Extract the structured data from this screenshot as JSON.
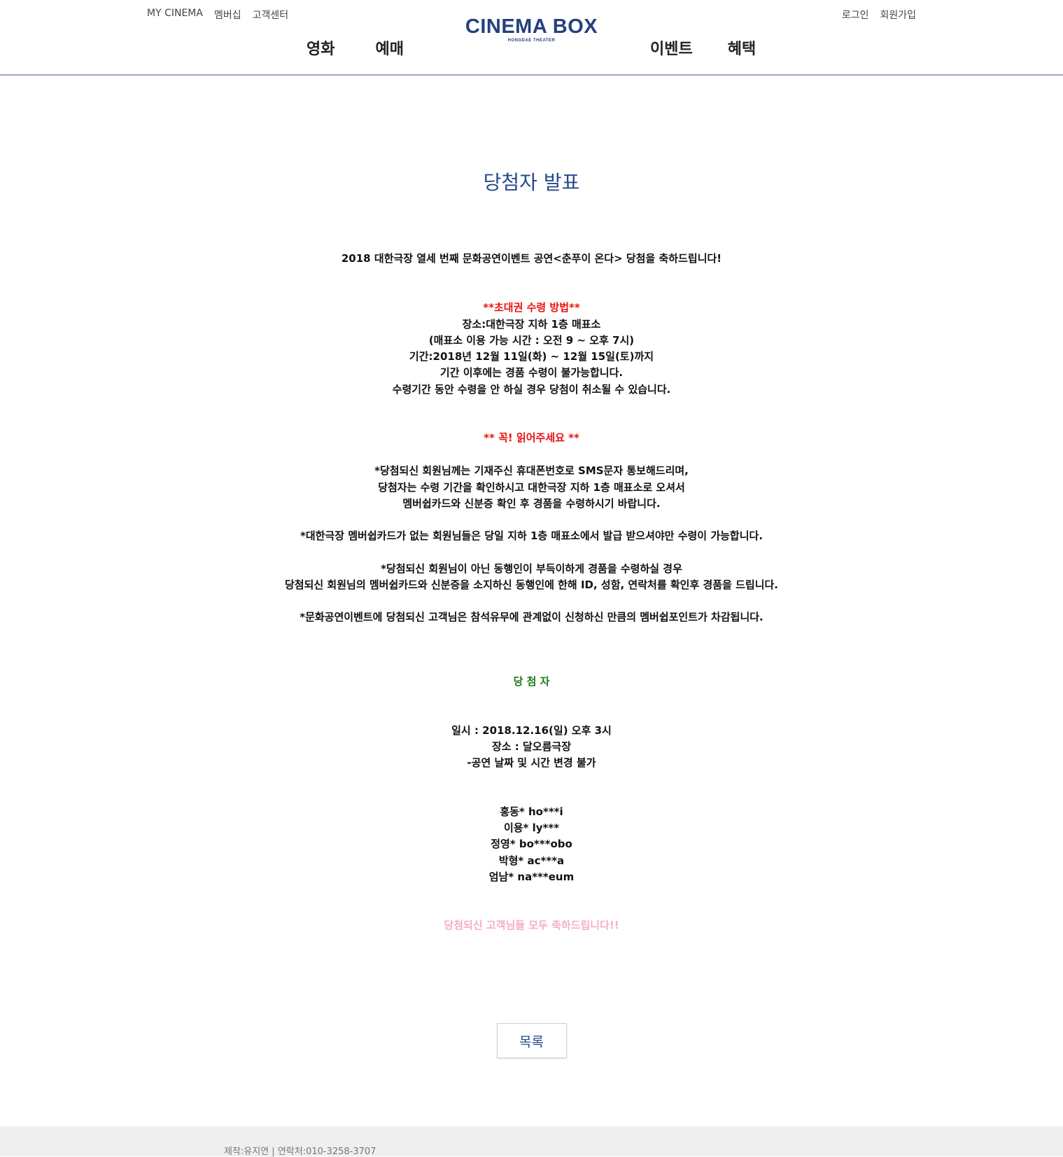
{
  "header": {
    "top_left_links": [
      "MY CINEMA",
      "멤버십",
      "고객센터"
    ],
    "top_right_links": [
      "로그인",
      "회원가입"
    ],
    "logo": {
      "main": "CINEMA BOX",
      "sub": "HONGDAE THEATER"
    },
    "nav_left": [
      "영화",
      "예매"
    ],
    "nav_right": [
      "이벤트",
      "혜택"
    ]
  },
  "page": {
    "title": "당첨자 발표"
  },
  "article": {
    "congrats": "2018 대한극장 열세 번째 문화공연이벤트 공연<춘푸이 온다> 당첨을 축하드립니다!",
    "pickup_heading": "**초대권 수령 방법**",
    "pickup_lines": [
      "장소:대한극장 지하 1층 매표소",
      "(매표소 이용 가능 시간 : 오전 9 ~ 오후 7시)",
      "기간:2018년 12월 11일(화) ~ 12월 15일(토)까지",
      "기간 이후에는 경품 수령이 불가능합니다.",
      "수령기간 동안 수령을 안 하실 경우 당첨이 취소될 수 있습니다."
    ],
    "notice_heading": "** 꼭! 읽어주세요 **",
    "notice_block_1": [
      "*당첨되신 회원님께는 기재주신 휴대폰번호로 SMS문자 통보해드리며,",
      "당첨자는 수령 기간을 확인하시고 대한극장 지하 1층 매표소로 오셔서",
      "멤버쉽카드와 신분증 확인 후 경품을 수령하시기 바랍니다."
    ],
    "notice_block_2": "*대한극장 멤버쉽카드가 없는 회원님들은 당일 지하 1층 매표소에서 발급 받으셔야만 수령이 가능합니다.",
    "notice_block_3": [
      "*당첨되신 회원님이 아닌 동행인이 부득이하게 경품을 수령하실 경우",
      "당첨되신 회원님의 멤버쉽카드와 신분증을 소지하신 동행인에 한해 ID, 성함, 연락처를 확인후 경품을 드립니다."
    ],
    "notice_block_4": "*문화공연이벤트에 당첨되신 고객님은 참석유무에 관계없이 신청하신 만큼의 멤버쉽포인트가 차감됩니다.",
    "winners_heading": "당 첨 자",
    "event_info": [
      "일시 : 2018.12.16(일) 오후 3시",
      "장소 : 달오름극장",
      "-공연 날짜 및 시간 변경 불가"
    ],
    "winners": [
      "홍동* ho***i",
      "이용* ly***",
      "정영* bo***obo",
      "박형* ac***a",
      "엄남* na***eum"
    ],
    "closing": "당첨되신 고객님들 모두 축하드립니다!!"
  },
  "buttons": {
    "list_label": "목록"
  },
  "footer": {
    "text": "제작:유지연 | 연락처:010-3258-3707"
  },
  "colors": {
    "brand": "#26407f",
    "title": "#27498b",
    "red_heading": "#ee1111",
    "green_heading": "#1d7a1d",
    "pink_closing": "#f5aec6",
    "header_border": "#9aa8c0",
    "footer_bg": "#efefef"
  }
}
